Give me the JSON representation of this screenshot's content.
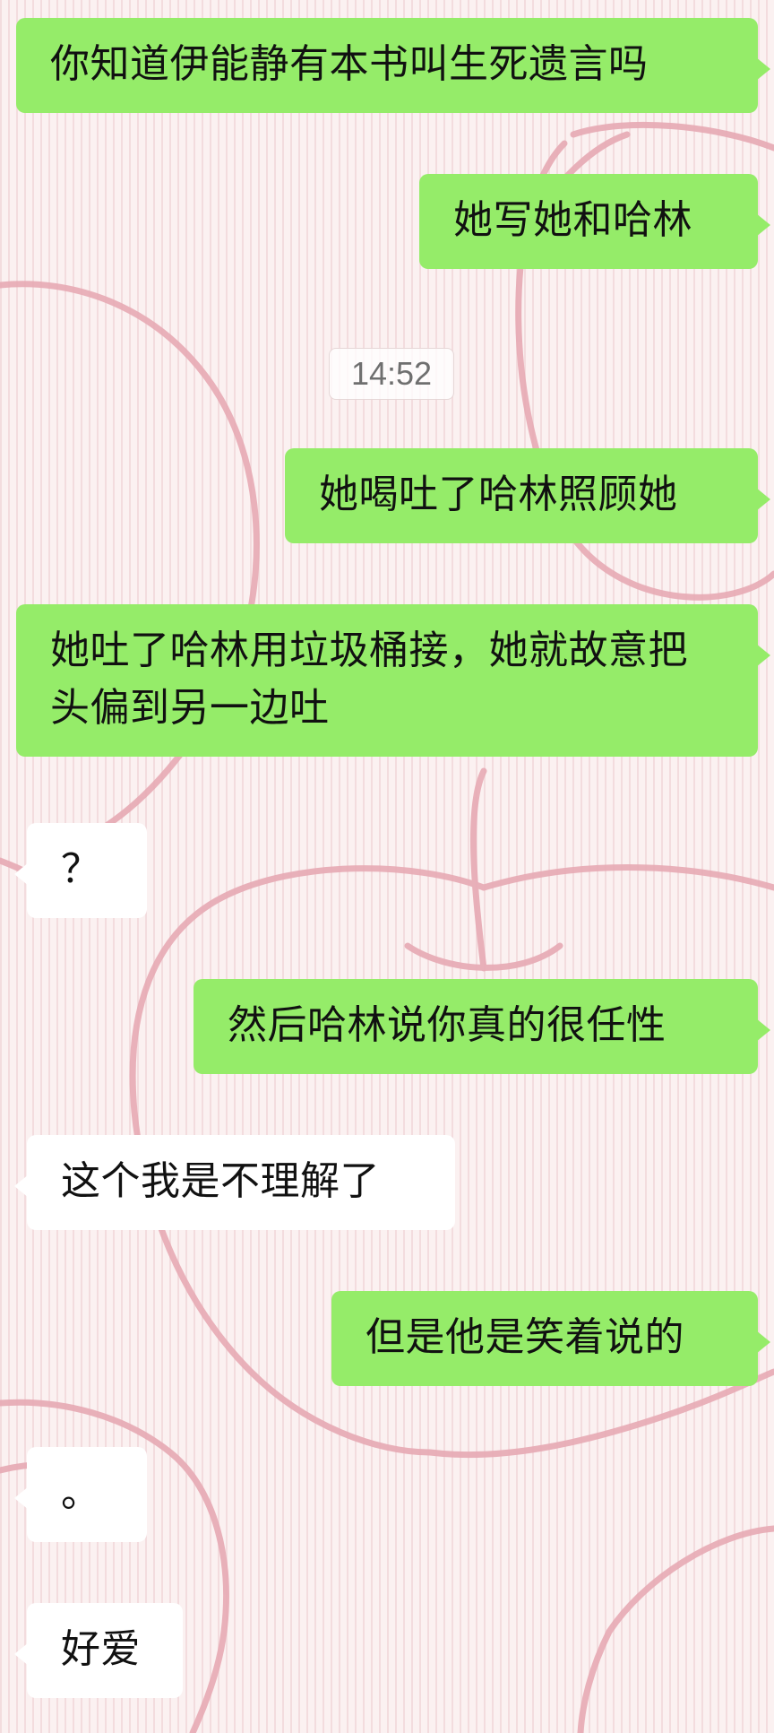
{
  "chat": {
    "timestamp": "14:52",
    "messages": [
      {
        "side": "out",
        "text": "你知道伊能静有本书叫生死遗言吗"
      },
      {
        "side": "out",
        "text": "她写她和哈林"
      },
      {
        "side": "out",
        "text": "她喝吐了哈林照顾她"
      },
      {
        "side": "out",
        "text": "她吐了哈林用垃圾桶接，她就故意把头偏到另一边吐"
      },
      {
        "side": "in",
        "text": "？"
      },
      {
        "side": "out",
        "text": "然后哈林说你真的很任性"
      },
      {
        "side": "in",
        "text": "这个我是不理解了"
      },
      {
        "side": "out",
        "text": "但是他是笑着说的"
      },
      {
        "side": "in",
        "text": "。"
      },
      {
        "side": "in",
        "text": "好爱"
      }
    ]
  },
  "colors": {
    "outgoing_bubble": "#95ec69",
    "incoming_bubble": "#ffffff",
    "background": "#fbf1f1",
    "doodle_stroke": "#e7aab4",
    "timestamp_text": "#6f6f6f"
  },
  "icons": {
    "background": "apple-doodle-wallpaper"
  }
}
